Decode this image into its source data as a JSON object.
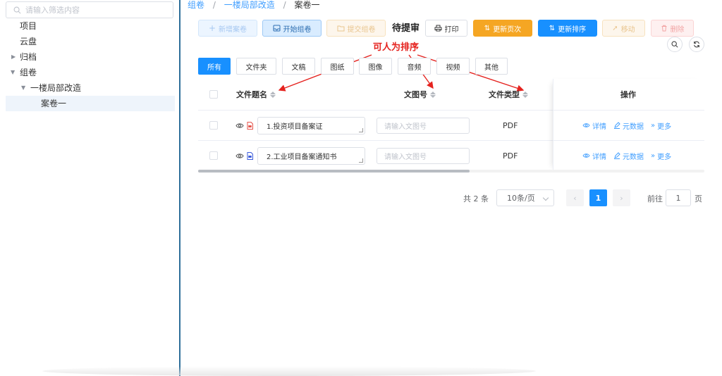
{
  "filter": {
    "placeholder": "请输入筛选内容",
    "icon": "search-icon"
  },
  "tree": [
    {
      "label": "项目"
    },
    {
      "label": "云盘"
    },
    {
      "label": "归档"
    },
    {
      "label": "组卷"
    },
    {
      "label": "一楼局部改造"
    },
    {
      "label": "案卷一"
    }
  ],
  "breadcrumb": {
    "item1": "组卷",
    "item2": "一楼局部改造",
    "sep": "/",
    "current": "案卷一"
  },
  "toolbar": {
    "add": "新增案卷",
    "start": "开始组卷",
    "submit": "提交组卷",
    "status": "待提审",
    "print": "打印",
    "update_page": "更新页次",
    "update_sort": "更新排序",
    "move": "移动",
    "delete": "删除"
  },
  "annotation": "可人为排序",
  "filters": [
    "所有",
    "文件夹",
    "文稿",
    "图纸",
    "图像",
    "音频",
    "视频",
    "其他"
  ],
  "table": {
    "headers": {
      "title": "文件题名",
      "number": "文图号",
      "type": "文件类型",
      "action": "操作"
    },
    "rows": [
      {
        "title": "1.投资项目备案证",
        "number_placeholder": "请输入文图号",
        "type": "PDF",
        "file_icon": "pdf-file-icon"
      },
      {
        "title": "2.工业项目备案通知书",
        "number_placeholder": "请输入文图号",
        "type": "PDF",
        "file_icon": "document-file-icon"
      }
    ],
    "actions": {
      "detail": "详情",
      "meta": "元数据",
      "more": "更多"
    }
  },
  "pagination": {
    "total": "共 2 条",
    "page_size": "10条/页",
    "current": "1",
    "goto_prefix": "前往",
    "goto_value": "1",
    "goto_suffix": "页"
  },
  "colors": {
    "primary": "#1890ff",
    "warning": "#f5a623",
    "annotation": "#e5231f",
    "sidebar_border": "#2f6f9a"
  }
}
